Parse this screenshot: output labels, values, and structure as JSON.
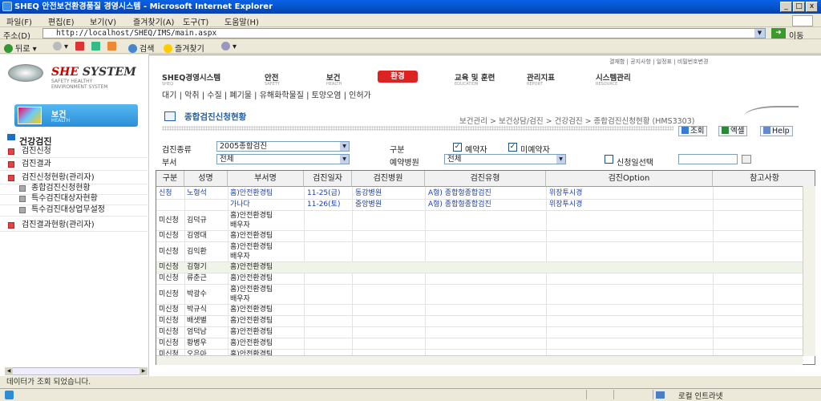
{
  "window": {
    "title": "SHEQ 안전보건환경품질 경영시스템 - Microsoft Internet Explorer"
  },
  "menu": [
    "파일(F)",
    "편집(E)",
    "보기(V)",
    "즐겨찾기(A)",
    "도구(T)",
    "도움말(H)"
  ],
  "address": {
    "label": "주소(D)",
    "url": "http://localhost/SHEQ/IMS/main.aspx",
    "go": "이동"
  },
  "toolbar": {
    "back": "뒤로",
    "search": "검색",
    "favorites": "즐겨찾기"
  },
  "logo": {
    "brand": "SHE",
    "brand2": "SYSTEM",
    "sub1": "SAFETY HEALTHY",
    "sub2": "ENVIRONMENT SYSTEM"
  },
  "health": {
    "label": "보건",
    "sub": "HEALTH"
  },
  "sidebar": {
    "title": "건강검진",
    "items": [
      "검진신청",
      "검진결과",
      "검진신청현황(관리자)",
      "종합검진신청현황",
      "특수검진대상자현황",
      "특수검진대상업무설정",
      "검진결과현황(관리자)"
    ]
  },
  "toplinks": "결재함 | 공지사항 | 일정표 | 비밀번호변경",
  "mainnav": [
    {
      "label": "SHEQ경영시스템",
      "sub": "SHEQ"
    },
    {
      "label": "안전",
      "sub": "SAFETY"
    },
    {
      "label": "보건",
      "sub": "HEALTH"
    },
    {
      "label": "환경",
      "sub": ""
    },
    {
      "label": "교육 및 훈련",
      "sub": "EDUCATION"
    },
    {
      "label": "관리지표",
      "sub": "REPORT"
    },
    {
      "label": "시스템관리",
      "sub": "RESOURCE"
    }
  ],
  "subnav": "대기 | 악취 | 수질 | 폐기물 | 유해화학물질 | 토양오염 | 인허가",
  "page": {
    "title": "종합검진신청현황",
    "breadcrumb": "보건관리 > 보건상담/검진 > 건강검진 > 종합검진신청현황 (HMS3303)"
  },
  "actions": {
    "search": "조회",
    "excel": "엑셀",
    "help": "Help"
  },
  "filters": {
    "type_label": "검진종류",
    "type_value": "2005종합검진",
    "dept_label": "부서",
    "dept_value": "전체",
    "category_label": "구분",
    "reserved": "예약자",
    "not_reserved": "미예약자",
    "hospital_label": "예약병원",
    "hospital_value": "전체",
    "date_check": "신청일선택"
  },
  "table": {
    "headers": [
      "구분",
      "성명",
      "부서명",
      "검진일자",
      "검진병원",
      "검진유형",
      "검진Option",
      "참고사항"
    ],
    "rows": [
      {
        "gubun": "신청",
        "name": "노형석",
        "dept": "홈)안전환경팀",
        "date": "11-25(금)",
        "hospital": "동강병원",
        "type": "A형) 종합형종합검진",
        "option": "위장투시경"
      },
      {
        "gubun": "",
        "name": "",
        "dept": "가나다",
        "date": "11-26(토)",
        "hospital": "중앙병원",
        "type": "A형) 종합형종합검진",
        "option": "위장투시경"
      },
      {
        "gubun": "미신청",
        "name": "김덕규",
        "dept": "홈)안전환경팀",
        "dept2": "배우자"
      },
      {
        "gubun": "미신청",
        "name": "김영대",
        "dept": "홈)안전환경팀"
      },
      {
        "gubun": "미신청",
        "name": "김익환",
        "dept": "홈)안전환경팀",
        "dept2": "배우자"
      },
      {
        "gubun": "미신청",
        "name": "김형기",
        "dept": "홈)안전환경팀"
      },
      {
        "gubun": "미신청",
        "name": "류춘근",
        "dept": "홈)안전환경팀"
      },
      {
        "gubun": "미신청",
        "name": "박광수",
        "dept": "홈)안전환경팀",
        "dept2": "배우자"
      },
      {
        "gubun": "미신청",
        "name": "박규식",
        "dept": "홈)안전환경팀"
      },
      {
        "gubun": "미신청",
        "name": "배샛별",
        "dept": "홈)안전환경팀"
      },
      {
        "gubun": "미신청",
        "name": "엄덕남",
        "dept": "홈)안전환경팀"
      },
      {
        "gubun": "미신청",
        "name": "황병우",
        "dept": "홈)안전환경팀"
      },
      {
        "gubun": "미신청",
        "name": "오은아",
        "dept": "홈)안전환경팀"
      }
    ]
  },
  "status": {
    "text": "데이터가 조회 되었습니다.",
    "zone": "로컬 인트라넷"
  }
}
